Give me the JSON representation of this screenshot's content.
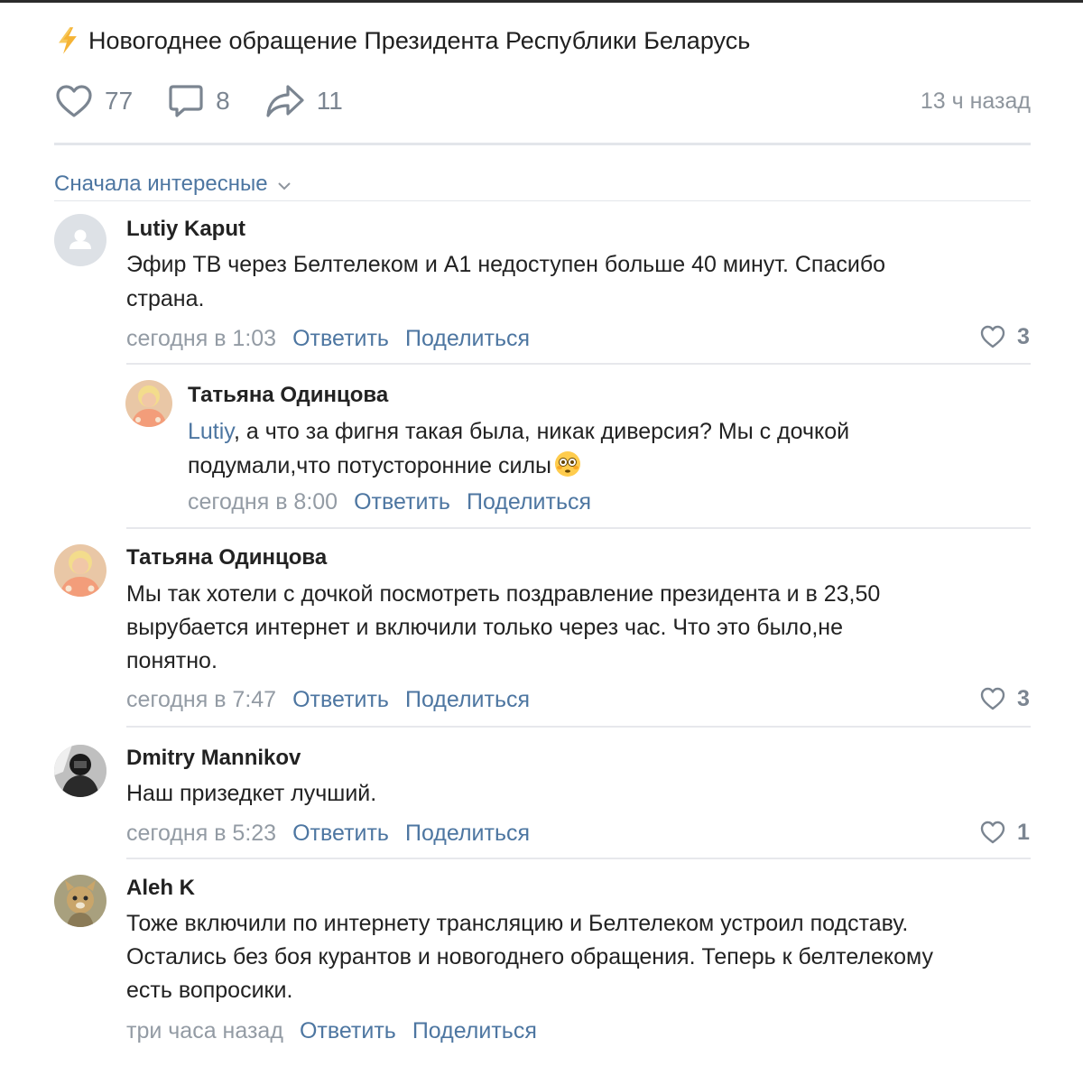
{
  "post": {
    "title": "Новогоднее обращение Президента Республики Беларусь",
    "likes": "77",
    "comments": "8",
    "shares": "11",
    "time": "13 ч назад",
    "bolt_icon": "lightning-icon"
  },
  "sort": {
    "label": "Сначала интересные"
  },
  "comments": [
    {
      "author": "Lutiy Kaput",
      "text_lines": [
        "Эфир ТВ через Белтелеком и А1 недоступен больше 40 минут. Спасибо",
        "страна."
      ],
      "date": "сегодня в 1:03",
      "reply": "Ответить",
      "share": "Поделиться",
      "likes": "3"
    },
    {
      "author": "Татьяна Одинцова",
      "mention": "Lutiy",
      "text_line1_rest": ", а что за фигня такая была, никак диверсия? Мы с дочкой",
      "text_line2": "подумали,что потусторонние силы",
      "emoji": "😳",
      "date": "сегодня в 8:00",
      "reply": "Ответить",
      "share": "Поделиться"
    },
    {
      "author": "Татьяна Одинцова",
      "text_lines": [
        "Мы так хотели с дочкой посмотреть поздравление президента и в 23,50",
        "вырубается интернет и включили только через час. Что это было,не",
        "понятно."
      ],
      "date": "сегодня в 7:47",
      "reply": "Ответить",
      "share": "Поделиться",
      "likes": "3"
    },
    {
      "author": "Dmitry Mannikov",
      "text_lines": [
        "Наш призедкет лучший."
      ],
      "date": "сегодня в 5:23",
      "reply": "Ответить",
      "share": "Поделиться",
      "likes": "1"
    },
    {
      "author": "Aleh K",
      "text_lines": [
        "Тоже включили по интернету трансляцию и Белтелеком устроил подставу.",
        "Остались без боя курантов и новогоднего обращения. Теперь к белтелекому",
        "есть вопросики."
      ],
      "date": "три часа назад",
      "reply": "Ответить",
      "share": "Поделиться"
    }
  ],
  "colors": {
    "link": "#4d76a1",
    "muted": "#939ba4",
    "divider": "#e7e8ec",
    "text": "#222222"
  }
}
